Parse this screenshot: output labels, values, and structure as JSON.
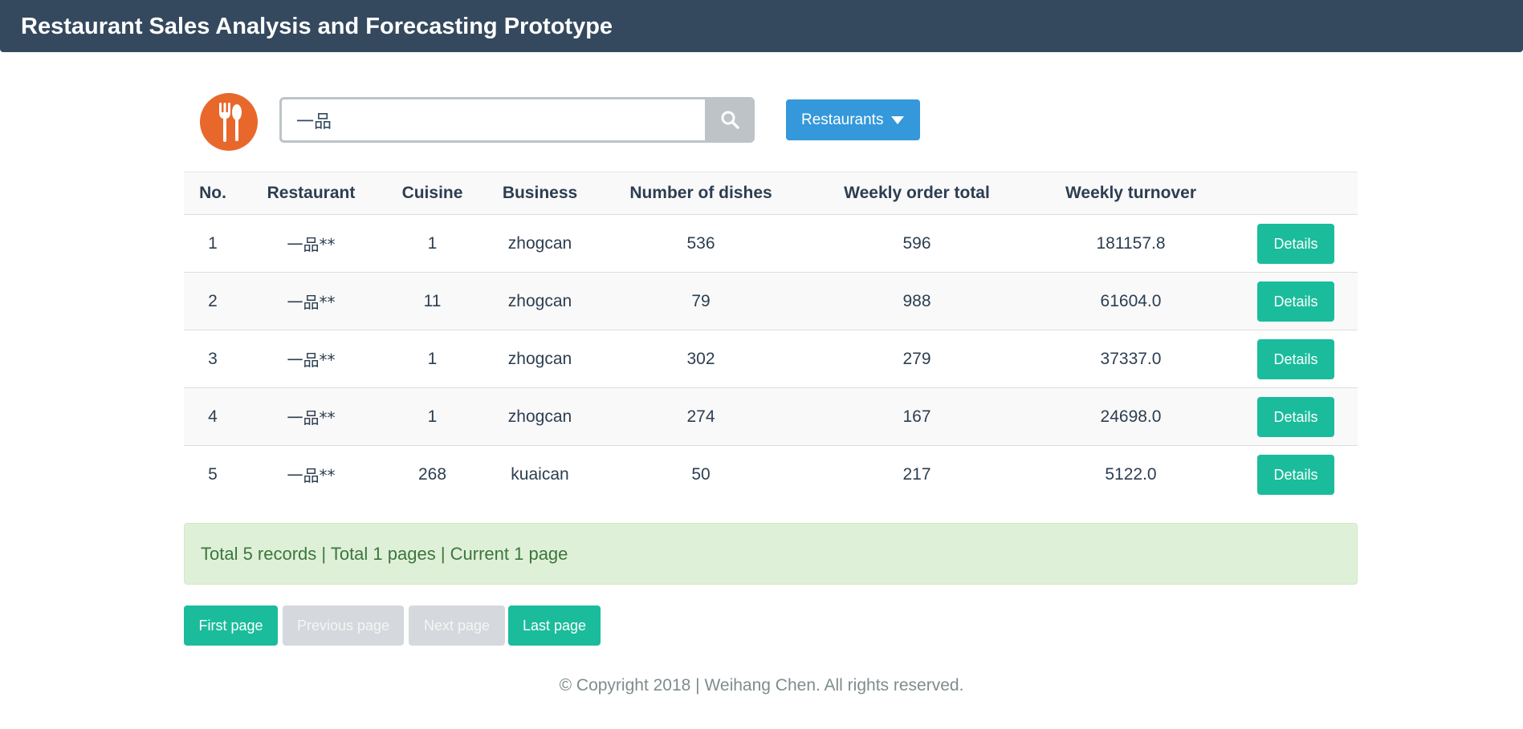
{
  "navbar": {
    "title": "Restaurant Sales Analysis and Forecasting Prototype"
  },
  "logo": {
    "icon": "fork-spoon-icon",
    "color": "#e8682c"
  },
  "search": {
    "value": "一品",
    "button_icon": "search-icon"
  },
  "dropdown": {
    "label": "Restaurants",
    "icon": "caret-down-icon"
  },
  "table": {
    "headers": [
      "No.",
      "Restaurant",
      "Cuisine",
      "Business",
      "Number of dishes",
      "Weekly order total",
      "Weekly turnover",
      ""
    ],
    "rows": [
      {
        "no": "1",
        "restaurant": "一品**",
        "cuisine": "1",
        "business": "zhogcan",
        "dishes": "536",
        "orders": "596",
        "turnover": "181157.8",
        "action": "Details"
      },
      {
        "no": "2",
        "restaurant": "一品**",
        "cuisine": "11",
        "business": "zhogcan",
        "dishes": "79",
        "orders": "988",
        "turnover": "61604.0",
        "action": "Details"
      },
      {
        "no": "3",
        "restaurant": "一品**",
        "cuisine": "1",
        "business": "zhogcan",
        "dishes": "302",
        "orders": "279",
        "turnover": "37337.0",
        "action": "Details"
      },
      {
        "no": "4",
        "restaurant": "一品**",
        "cuisine": "1",
        "business": "zhogcan",
        "dishes": "274",
        "orders": "167",
        "turnover": "24698.0",
        "action": "Details"
      },
      {
        "no": "5",
        "restaurant": "一品**",
        "cuisine": "268",
        "business": "kuaican",
        "dishes": "50",
        "orders": "217",
        "turnover": "5122.0",
        "action": "Details"
      }
    ]
  },
  "summary": {
    "text": "Total 5 records | Total 1 pages | Current 1 page"
  },
  "pagination": {
    "first": "First page",
    "previous": "Previous page",
    "next": "Next page",
    "last": "Last page"
  },
  "footer": {
    "text": "© Copyright 2018  |  Weihang Chen. All rights reserved."
  },
  "colors": {
    "navbar": "#34495e",
    "primary": "#1abc9c",
    "dropdown": "#3498db",
    "disabled": "#d5d8dc",
    "success_bg": "#dff0d8",
    "success_text": "#3c763d"
  }
}
